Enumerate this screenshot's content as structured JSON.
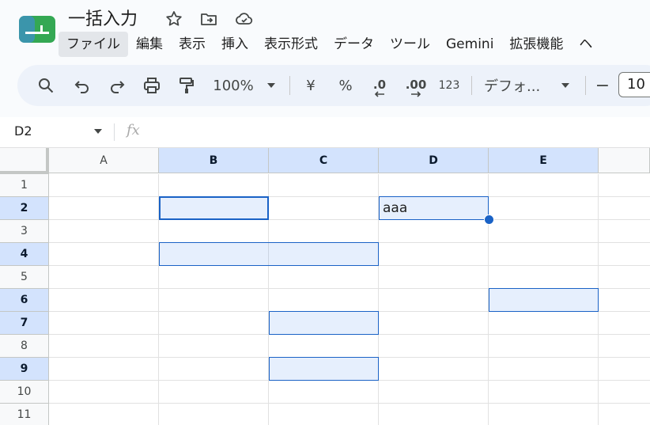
{
  "app": {
    "doc_title": "一括入力"
  },
  "menu": {
    "items": [
      "ファイル",
      "編集",
      "表示",
      "挿入",
      "表示形式",
      "データ",
      "ツール",
      "Gemini",
      "拡張機能",
      "ヘ"
    ]
  },
  "toolbar": {
    "zoom": "100%",
    "currency": "¥",
    "percent": "%",
    "decimal_decrease": ".0",
    "decimal_increase": ".00",
    "number_format": "123",
    "font_name": "デフォ...",
    "font_size": "10",
    "decrease_font": "−"
  },
  "formula_bar": {
    "name_box": "D2",
    "fx": "fx"
  },
  "grid": {
    "columns": [
      "A",
      "B",
      "C",
      "D",
      "E"
    ],
    "selected_columns": [
      "B",
      "C",
      "D",
      "E"
    ],
    "rows": [
      "1",
      "2",
      "3",
      "4",
      "5",
      "6",
      "7",
      "8",
      "9",
      "10",
      "11"
    ],
    "selected_rows": [
      "2",
      "4",
      "6",
      "7",
      "9"
    ],
    "cells": {
      "D2": "aaa"
    }
  },
  "colors": {
    "selection_border": "#1a62c6",
    "header_selected": "#d3e3fd"
  }
}
